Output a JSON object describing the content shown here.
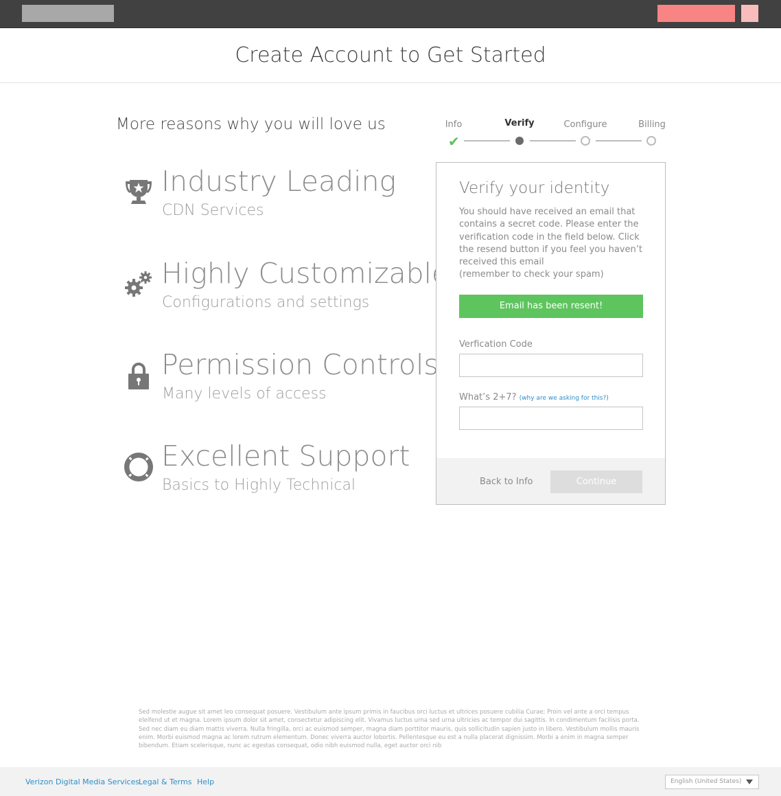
{
  "header": {
    "title": "Create Account to Get Started"
  },
  "reasons": {
    "title": "More reasons why you will love us",
    "items": [
      {
        "icon": "trophy-icon",
        "title": "Industry Leading",
        "subtitle": "CDN Services"
      },
      {
        "icon": "gears-icon",
        "title": "Highly Customizable",
        "subtitle": "Configurations and settings"
      },
      {
        "icon": "lock-icon",
        "title": "Permission Controls",
        "subtitle": "Many levels of access"
      },
      {
        "icon": "lifebuoy-icon",
        "title": "Excellent Support",
        "subtitle": "Basics to Highly Technical"
      }
    ]
  },
  "steps": [
    {
      "label": "Info",
      "state": "done"
    },
    {
      "label": "Verify",
      "state": "current"
    },
    {
      "label": "Configure",
      "state": "pending"
    },
    {
      "label": "Billing",
      "state": "pending"
    }
  ],
  "verify": {
    "title": "Verify your identity",
    "description_lines": [
      "You should have received an email that",
      "contains a secret code. Please enter the",
      "verification code in the field below. Click",
      "the resend button if you feel you haven’t",
      "received this email",
      "(remember to check your spam)"
    ],
    "alert": "Email has been resent!",
    "code_label": "Verfication Code",
    "code_value": "",
    "captcha_label": "What’s 2+7?",
    "captcha_hint": "(why are we asking for this?)",
    "captcha_value": "",
    "back_label": "Back to Info",
    "continue_label": "Continue"
  },
  "legal_text": "Sed molestie augue sit amet leo consequat posuere. Vestibulum ante ipsum primis in faucibus orci luctus et ultrices posuere cubilia Curae; Proin vel ante a orci tempus eleifend ut et magna. Lorem ipsum dolor sit amet, consectetur adipiscing elit. Vivamus luctus urna sed urna ultricies ac tempor dui sagittis. In condimentum facilisis porta. Sed nec diam eu diam mattis viverra. Nulla fringilla, orci ac euismod semper, magna diam porttitor mauris, quis sollicitudin sapien justo in libero. Vestibulum mollis mauris enim. Morbi euismod magna ac lorem rutrum elementum. Donec viverra auctor lobortis. Pellentesque eu est a nulla placerat dignissim. Morbi a enim in magna semper bibendum. Etiam scelerisque, nunc ac egestas consequat, odio nibh euismod nulla, eget auctor orci nib",
  "footer": {
    "links": [
      "Verizon Digital Media Services",
      "Legal & Terms",
      "Help"
    ],
    "language": "English (United States)"
  },
  "colors": {
    "topbar": "#414141",
    "accent_red": "#f88484",
    "success": "#5ec45e",
    "link": "#2a8fc9"
  }
}
